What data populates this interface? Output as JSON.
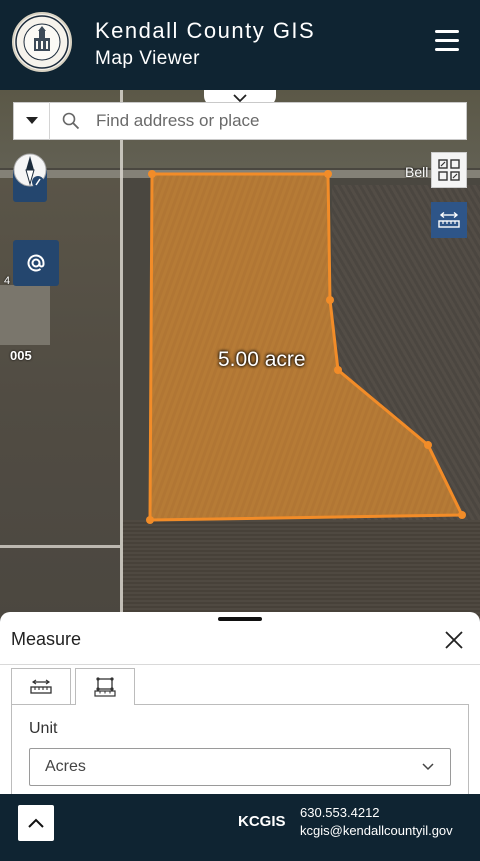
{
  "header": {
    "title": "Kendall County GIS",
    "subtitle": "Map Viewer",
    "seal_text": "KENDALL COUNTY ILLINOIS"
  },
  "map": {
    "search_placeholder": "Find address or place",
    "area_label": "5.00 acre",
    "street_label": "Bell",
    "parcel_number": "005",
    "parcel_number_partial": "4",
    "parcel_color": "#f28c28"
  },
  "measure": {
    "title": "Measure",
    "unit_label": "Unit",
    "unit_value": "Acres",
    "tabs": [
      {
        "name": "distance",
        "icon": "ruler-distance-icon",
        "active": false
      },
      {
        "name": "area",
        "icon": "area-measure-icon",
        "active": true
      }
    ]
  },
  "footer": {
    "brand": "KCGIS",
    "phone": "630.553.4212",
    "email": "kcgis@kendallcountyil.gov"
  },
  "colors": {
    "header_bg": "#0f2432",
    "tool_button": "#24466e",
    "parcel_outline": "#f28c28"
  }
}
